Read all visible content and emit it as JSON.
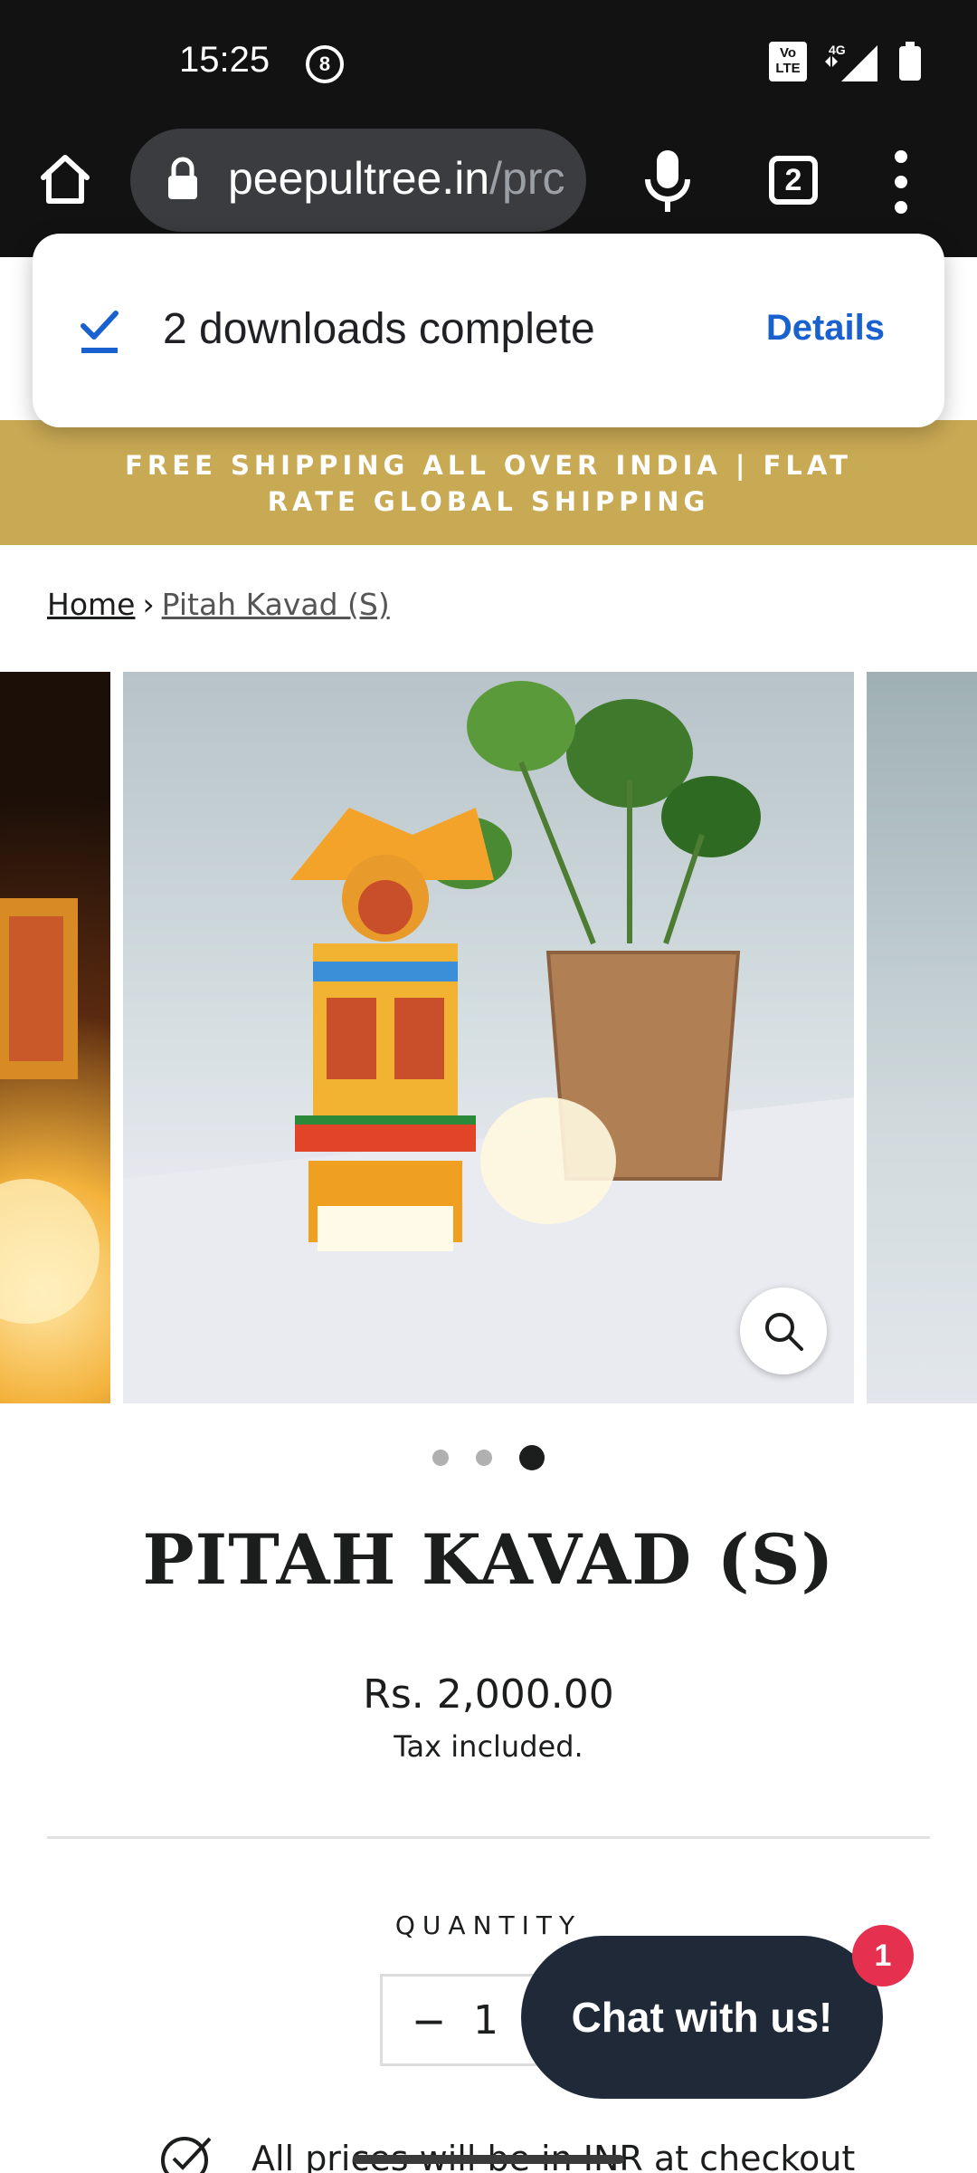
{
  "status_bar": {
    "time": "15:25",
    "notification_badge": "8",
    "network": "4G",
    "volte_label": "Vo LTE"
  },
  "browser": {
    "url_host": "peepultree.in",
    "url_path": "/prc",
    "tab_count": "2",
    "icons": [
      "home-icon",
      "lock-icon",
      "mic-icon",
      "tabs-icon",
      "more-vert-icon"
    ]
  },
  "download_toast": {
    "message": "2 downloads complete",
    "action": "Details",
    "accent": "#1a61d0"
  },
  "banner": {
    "text": "FREE SHIPPING ALL OVER INDIA | FLAT RATE GLOBAL SHIPPING",
    "bg_color": "#c8a954"
  },
  "breadcrumb": {
    "home": "Home",
    "separator": "›",
    "current": "Pitah Kavad (S)"
  },
  "gallery": {
    "slide_count": 3,
    "active_index": 2
  },
  "product": {
    "title": "PITAH KAVAD (S)",
    "price": "Rs. 2,000.00",
    "tax_note": "Tax included.",
    "quantity_label": "QUANTITY",
    "quantity_value": "1",
    "minus_symbol": "−"
  },
  "chat": {
    "label": "Chat with us!",
    "badge_count": "1",
    "bg_color": "#1f2937",
    "badge_color": "#e5304f"
  },
  "note": {
    "text": "All prices will be in INR at checkout"
  }
}
